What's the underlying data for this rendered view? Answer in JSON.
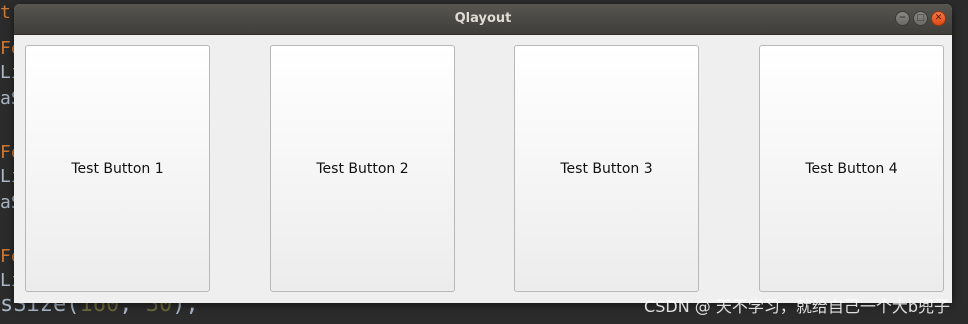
{
  "window": {
    "title": "Qlayout",
    "controls": {
      "minimize": "−",
      "maximize": "□",
      "close": "✕"
    }
  },
  "buttons": [
    {
      "label": "Test Button 1"
    },
    {
      "label": "Test Button 2"
    },
    {
      "label": "Test Button 3"
    },
    {
      "label": "Test Button 4"
    }
  ],
  "background_code": {
    "bottom_prefix": "sSize(",
    "bottom_arg1": "160",
    "bottom_sep": ", ",
    "bottom_arg2": "30",
    "bottom_suffix": ");"
  },
  "watermark": "CSDN @    天不学习，就给自己一个大b兜子"
}
